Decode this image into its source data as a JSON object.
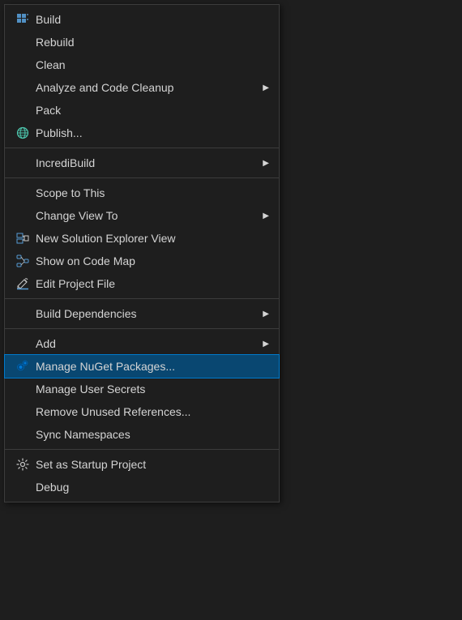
{
  "menu": {
    "items": [
      {
        "id": "build",
        "label": "Build",
        "hasIcon": true,
        "iconType": "build",
        "hasArrow": false,
        "hasSeparatorAfter": false
      },
      {
        "id": "rebuild",
        "label": "Rebuild",
        "hasIcon": false,
        "iconType": "",
        "hasArrow": false,
        "hasSeparatorAfter": false
      },
      {
        "id": "clean",
        "label": "Clean",
        "hasIcon": false,
        "iconType": "",
        "hasArrow": false,
        "hasSeparatorAfter": false
      },
      {
        "id": "analyze",
        "label": "Analyze and Code Cleanup",
        "hasIcon": false,
        "iconType": "",
        "hasArrow": true,
        "hasSeparatorAfter": false
      },
      {
        "id": "pack",
        "label": "Pack",
        "hasIcon": false,
        "iconType": "",
        "hasArrow": false,
        "hasSeparatorAfter": false
      },
      {
        "id": "publish",
        "label": "Publish...",
        "hasIcon": true,
        "iconType": "globe",
        "hasArrow": false,
        "hasSeparatorAfter": true
      },
      {
        "id": "incredibuild",
        "label": "IncrediBuild",
        "hasIcon": false,
        "iconType": "",
        "hasArrow": true,
        "hasSeparatorAfter": true
      },
      {
        "id": "scope",
        "label": "Scope to This",
        "hasIcon": false,
        "iconType": "",
        "hasArrow": false,
        "hasSeparatorAfter": false
      },
      {
        "id": "changeview",
        "label": "Change View To",
        "hasIcon": false,
        "iconType": "",
        "hasArrow": true,
        "hasSeparatorAfter": false
      },
      {
        "id": "newsolution",
        "label": "New Solution Explorer View",
        "hasIcon": true,
        "iconType": "sol-explorer",
        "hasArrow": false,
        "hasSeparatorAfter": false
      },
      {
        "id": "codemap",
        "label": "Show on Code Map",
        "hasIcon": true,
        "iconType": "codemap",
        "hasArrow": false,
        "hasSeparatorAfter": false
      },
      {
        "id": "editproject",
        "label": "Edit Project File",
        "hasIcon": true,
        "iconType": "edit",
        "hasArrow": false,
        "hasSeparatorAfter": true
      },
      {
        "id": "builddeps",
        "label": "Build Dependencies",
        "hasIcon": false,
        "iconType": "",
        "hasArrow": true,
        "hasSeparatorAfter": true
      },
      {
        "id": "add",
        "label": "Add",
        "hasIcon": false,
        "iconType": "",
        "hasArrow": true,
        "hasSeparatorAfter": false
      },
      {
        "id": "nuget",
        "label": "Manage NuGet Packages...",
        "hasIcon": true,
        "iconType": "nuget",
        "hasArrow": false,
        "hasSeparatorAfter": false,
        "highlighted": true
      },
      {
        "id": "usersecrets",
        "label": "Manage User Secrets",
        "hasIcon": false,
        "iconType": "",
        "hasArrow": false,
        "hasSeparatorAfter": false
      },
      {
        "id": "removeunused",
        "label": "Remove Unused References...",
        "hasIcon": false,
        "iconType": "",
        "hasArrow": false,
        "hasSeparatorAfter": false
      },
      {
        "id": "syncns",
        "label": "Sync Namespaces",
        "hasIcon": false,
        "iconType": "",
        "hasArrow": false,
        "hasSeparatorAfter": true
      },
      {
        "id": "startup",
        "label": "Set as Startup Project",
        "hasIcon": true,
        "iconType": "gear",
        "hasArrow": false,
        "hasSeparatorAfter": false
      },
      {
        "id": "debug",
        "label": "Debug",
        "hasIcon": false,
        "iconType": "",
        "hasArrow": false,
        "hasSeparatorAfter": false
      }
    ]
  }
}
